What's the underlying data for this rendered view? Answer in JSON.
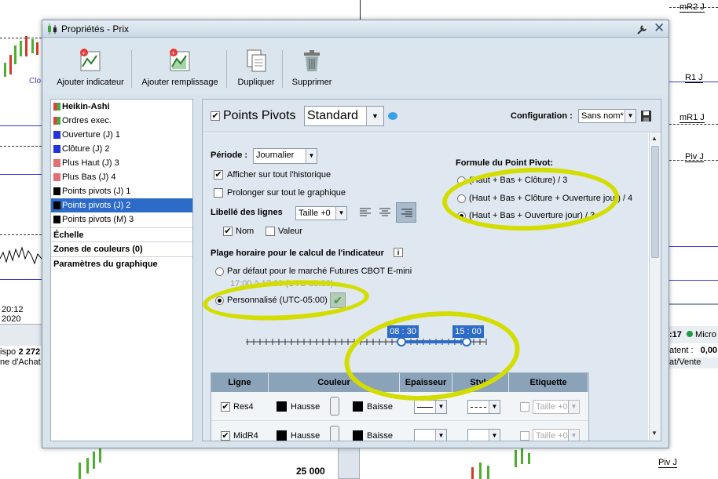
{
  "background": {
    "right_labels": [
      "mR2 J",
      "R1 J",
      "mR1 J",
      "Piv J",
      "Piv J"
    ],
    "left_labels": {
      "clo": "Clo",
      "time": "20:12",
      "year": "2020",
      "dispo": "ispo",
      "dispo_val": "2 272",
      "achat": "ne d'Achat"
    },
    "right_panel": {
      "micro": "Micro",
      "time": ":17",
      "atent": "atent :",
      "atent_val": "0,00",
      "achat_vente": "at/Vente"
    },
    "bottom_price": "25 000"
  },
  "dialog": {
    "title": "Propriétés - Prix",
    "toolbar": [
      {
        "label": "Ajouter indicateur"
      },
      {
        "label": "Ajouter remplissage"
      },
      {
        "label": "Dupliquer"
      },
      {
        "label": "Supprimer"
      }
    ],
    "left_list": [
      {
        "label": "Heikin-Ashi",
        "color": "#d9433a",
        "bold": true
      },
      {
        "label": "Ordres exec.",
        "color": "#3fae3f"
      },
      {
        "label": "Ouverture (J) 1",
        "color": "#2233dd"
      },
      {
        "label": "Clôture (J) 2",
        "color": "#2233dd"
      },
      {
        "label": "Plus Haut (J) 3",
        "color": "#e46f73"
      },
      {
        "label": "Plus Bas (J) 4",
        "color": "#e46f73"
      },
      {
        "label": "Points pivots (J) 1",
        "color": "#000000"
      },
      {
        "label": "Points pivots (J) 2",
        "color": "#000000"
      },
      {
        "label": "Points pivots (M) 3",
        "color": "#000000"
      }
    ],
    "left_sections": [
      "Échelle",
      "Zones de couleurs (0)",
      "Paramètres du graphique"
    ],
    "indicator": {
      "name": "Points Pivots",
      "type": "Standard",
      "config_label": "Configuration :",
      "config_value": "Sans nom*"
    },
    "period": {
      "label": "Période :",
      "value": "Journalier"
    },
    "opt_history": "Afficher sur tout l'historique",
    "opt_extend": "Prolonger sur tout le graphique",
    "labels_section": {
      "label": "Libellé des lignes",
      "size": "Taille +0",
      "name": "Nom",
      "value": "Valeur"
    },
    "formula": {
      "title": "Formule du Point Pivot:",
      "options": [
        "(Haut + Bas + Clôture) / 3",
        "(Haut + Bas +  Clôture + Ouverture jour) / 4",
        "(Haut + Bas + Ouverture jour) / 3"
      ],
      "selected": 2
    },
    "hours": {
      "title": "Plage horaire pour le calcul de l'indicateur",
      "default_option": "Par défaut pour le marché Futures CBOT E-mini",
      "default_range": "17:00 à 17:00 (UTC-05:00)",
      "custom_option": "Personnalisé (UTC-05:00)",
      "start": "08 : 30",
      "end": "15 : 00"
    },
    "table": {
      "headers": [
        "Ligne",
        "Couleur",
        "Epaisseur",
        "Style",
        "Etiquette"
      ],
      "rows": [
        {
          "name": "Res4",
          "up": "Hausse",
          "down": "Baisse",
          "label": "Taille +0"
        },
        {
          "name": "MidR4",
          "up": "Hausse",
          "down": "Baisse",
          "label": "Taille +0"
        }
      ]
    },
    "accent": "#2d6bc8",
    "highlight_color": "#d4dd00"
  }
}
